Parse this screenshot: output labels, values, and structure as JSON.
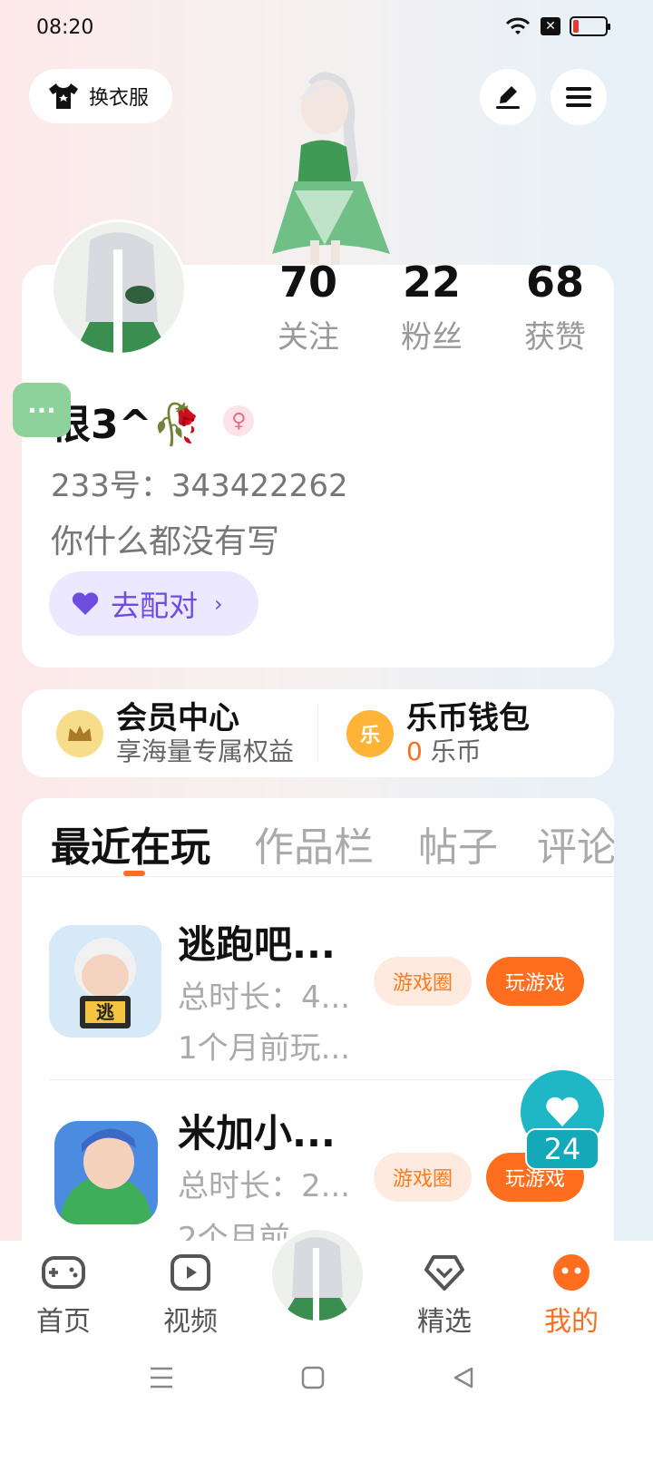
{
  "status_bar": {
    "time": "08:20"
  },
  "header": {
    "dress_label": "换衣服"
  },
  "profile": {
    "stats": [
      {
        "value": "70",
        "label": "关注"
      },
      {
        "value": "22",
        "label": "粉丝"
      },
      {
        "value": "68",
        "label": "获赞"
      }
    ],
    "more_label": "···",
    "username": "恨3^🥀",
    "gender_symbol": "♀",
    "uid": "233号：343422262",
    "bio": "你什么都没有写",
    "match_label": "去配对"
  },
  "vip": {
    "member_title": "会员中心",
    "member_sub": "享海量专属权益",
    "wallet_icon_text": "乐",
    "wallet_title": "乐币钱包",
    "wallet_amount": "0",
    "wallet_unit": "乐币"
  },
  "tabs": [
    "最近在玩",
    "作品栏",
    "帖子",
    "评论"
  ],
  "games": [
    {
      "title": "逃跑吧...",
      "duration": "总时长：4...",
      "last_played": "1个月前玩...",
      "circle_label": "游戏圈",
      "play_label": "玩游戏",
      "icon_text": "逃"
    },
    {
      "title": "米加小...",
      "duration": "总时长：2...",
      "last_played": "2个月前",
      "circle_label": "游戏圈",
      "play_label": "玩游戏"
    }
  ],
  "like_float": {
    "count": "24"
  },
  "bottom_nav": [
    {
      "label": "首页",
      "icon": "gamepad-icon"
    },
    {
      "label": "视频",
      "icon": "video-icon"
    },
    {
      "label": "精选",
      "icon": "heart-diamond-icon"
    },
    {
      "label": "我的",
      "icon": "profile-face-icon"
    }
  ],
  "colors": {
    "accent": "#ff6d1f",
    "match": "#6d4ce0",
    "like": "#1fb6c6"
  }
}
